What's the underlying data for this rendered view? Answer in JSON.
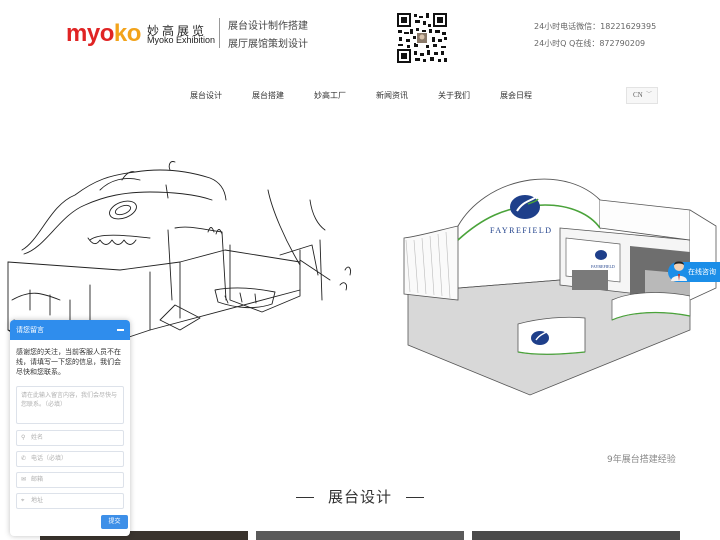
{
  "header": {
    "logo_part1": "myo",
    "logo_part2": "ko",
    "brand_cn": "妙高展览",
    "brand_en": "Myoko Exhibition",
    "slogan_line1": "展台设计制作搭建",
    "slogan_line2": "展厅展馆策划设计",
    "contact_phone": "24小时电话微信：18221629395",
    "contact_qq": "24小时Q Q在线：872790209",
    "brand_colors": {
      "red": "#e02424",
      "orange": "#f2a31b"
    }
  },
  "nav": {
    "items": [
      {
        "label": "展台设计"
      },
      {
        "label": "展台搭建"
      },
      {
        "label": "妙高工厂"
      },
      {
        "label": "新闻资讯"
      },
      {
        "label": "关于我们"
      },
      {
        "label": "展会日程"
      }
    ],
    "language": "CN",
    "language_icon": "chevron-down-icon"
  },
  "banner": {
    "brand_text": "FAYREFIELD",
    "caption": "9年展台搭建经验"
  },
  "section": {
    "title": "展台设计"
  },
  "consult": {
    "label": "在线咨询",
    "color": "#1b8ee8"
  },
  "chat": {
    "title": "请您留言",
    "message": "感谢您的关注，当前客服人员不在线，请填写一下您的信息，我们会尽快和您联系。",
    "textarea_placeholder": "请在此输入留言内容，我们会尽快与您联系。（必填）",
    "fields": [
      {
        "icon": "user-icon",
        "placeholder": "姓名"
      },
      {
        "icon": "phone-icon",
        "placeholder": "电话（必填）"
      },
      {
        "icon": "mail-icon",
        "placeholder": "邮箱"
      },
      {
        "icon": "location-icon",
        "placeholder": "地址"
      }
    ],
    "submit_label": "提交",
    "accent": "#2f8ded"
  }
}
